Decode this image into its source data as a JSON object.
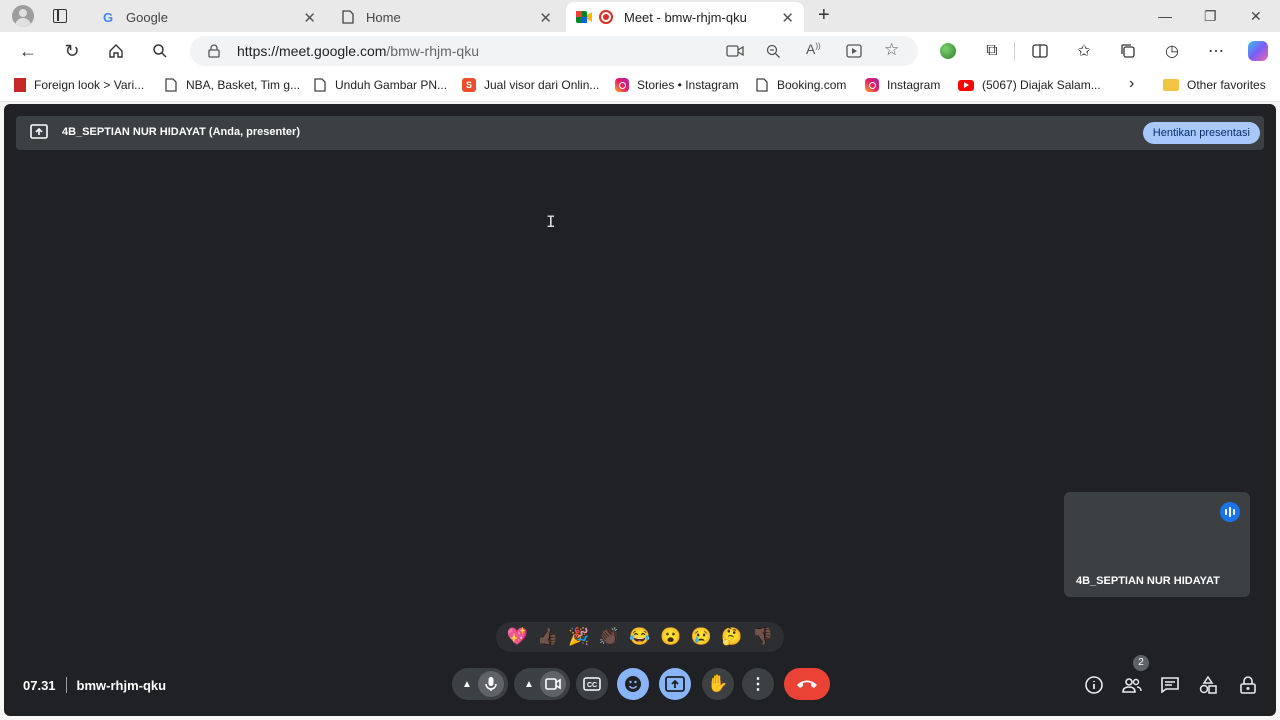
{
  "browser": {
    "tabs": [
      {
        "label": "Google",
        "icon": "google-icon"
      },
      {
        "label": "Home",
        "icon": "document-icon"
      },
      {
        "label": "Meet - bmw-rhjm-qku",
        "icon": "meet-icon"
      }
    ],
    "url_host": "https://meet.google.com",
    "url_path": "/bmw-rhjm-qku",
    "bookmarks": [
      "Foreign look > Vari...",
      "NBA, Basket, Tim g...",
      "Unduh Gambar PN...",
      "Jual visor dari Onlin...",
      "Stories • Instagram",
      "Booking.com",
      "Instagram",
      "(5067) Diajak Salam...",
      "Other favorites"
    ]
  },
  "meet": {
    "presenter_label": "4B_SEPTIAN NUR HIDAYAT (Anda, presenter)",
    "stop_presenting": "Hentikan presentasi",
    "self_name": "4B_SEPTIAN NUR HIDAYAT",
    "time": "07.31",
    "meeting_code": "bmw-rhjm-qku",
    "participant_count": "2",
    "reactions": [
      "💖",
      "👍🏿",
      "🎉",
      "👏🏿",
      "😂",
      "😮",
      "😢",
      "🤔",
      "👎🏿"
    ],
    "colors": {
      "background": "#202124",
      "accent": "#8ab4f8",
      "end_call": "#ea4335"
    }
  }
}
